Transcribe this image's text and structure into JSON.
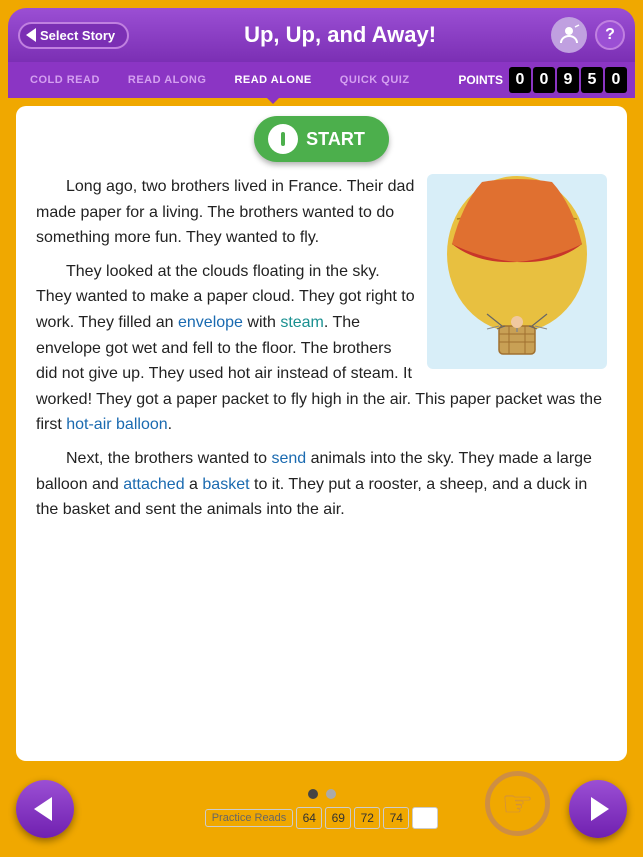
{
  "header": {
    "back_label": "Select Story",
    "title": "Up, Up, and Away!",
    "help_label": "?"
  },
  "tabs": {
    "items": [
      {
        "label": "COLD READ",
        "active": false
      },
      {
        "label": "READ ALONG",
        "active": false
      },
      {
        "label": "READ ALONE",
        "active": true
      },
      {
        "label": "QUICK QUIZ",
        "active": false
      }
    ],
    "points_label": "POINTS",
    "points_digits": [
      "0",
      "0",
      "9",
      "5",
      "0"
    ]
  },
  "content": {
    "start_label": "START",
    "paragraph1": "Long ago, two brothers lived in France. Their dad made paper for a living. The brothers wanted to do something more fun. They wanted to fly.",
    "paragraph2": "They looked at the clouds floating in the sky. They wanted to make a paper cloud. They got right to work. They filled an",
    "link_envelope": "envelope",
    "p2_mid": "with",
    "link_steam": "steam",
    "p2_end": ". The envelope got wet and fell to the floor. The brothers did not give up. They used hot air instead of steam. It worked! They got a paper packet to fly high in the air. This paper packet was the first",
    "link_balloon": "hot-air balloon",
    "p2_final": ".",
    "paragraph3_start": "Next, the brothers wanted to",
    "link_send": "send",
    "p3_mid": "animals into the sky. They made a large balloon and",
    "link_attached": "attached",
    "p3_mid2": "a",
    "link_basket": "basket",
    "p3_end": "to it. They put a rooster, a sheep, and a duck in the basket and sent the animals into the air."
  },
  "bottom": {
    "dots": [
      {
        "active": true
      },
      {
        "active": false
      }
    ],
    "practice_reads_label": "Practice Reads",
    "practice_scores": [
      "64",
      "69",
      "72",
      "74",
      ""
    ]
  }
}
